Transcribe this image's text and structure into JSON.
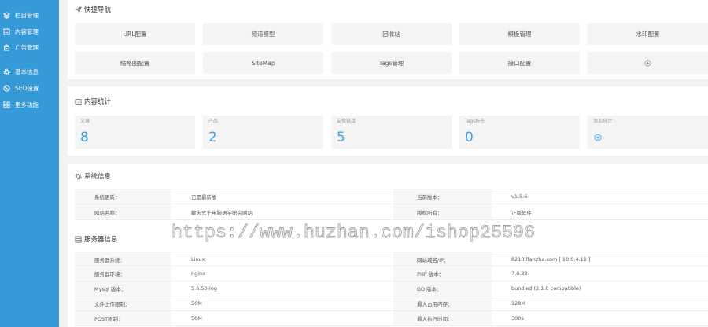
{
  "colors": {
    "sidebar": "#379ad8",
    "accent": "#3ea1e3",
    "page_bg": "#f1f2f4",
    "tile_bg": "#f4f4f4",
    "text": "#333333",
    "muted": "#999999"
  },
  "sidebar": {
    "items": [
      {
        "label": "栏目管理",
        "icon": "layers-icon"
      },
      {
        "label": "内容管理",
        "icon": "document-icon"
      },
      {
        "label": "广告管理",
        "icon": "ad-icon"
      },
      {
        "label": "基本信息",
        "icon": "gear-icon"
      },
      {
        "label": "SEO设置",
        "icon": "seo-icon"
      },
      {
        "label": "更多功能",
        "icon": "grid-icon"
      }
    ]
  },
  "quick_nav": {
    "title": "快捷导航",
    "title_icon": "send-icon",
    "items": [
      "URL配置",
      "频道模型",
      "回收站",
      "模板管理",
      "水印配置",
      "缩略图配置",
      "SiteMap",
      "Tags管理",
      "接口配置"
    ],
    "add_icon": "plus-circle-icon"
  },
  "stats": {
    "title": "内容统计",
    "title_icon": "stats-icon",
    "cards": [
      {
        "label": "文章",
        "value": "8"
      },
      {
        "label": "产品",
        "value": "2"
      },
      {
        "label": "友情链接",
        "value": "5"
      },
      {
        "label": "Tags标签",
        "value": "0"
      }
    ],
    "add": {
      "label": "添加统计",
      "icon": "plus-circle-icon"
    }
  },
  "system": {
    "title": "系统信息",
    "title_icon": "settings-icon",
    "rows": [
      [
        "系统更新：",
        "已是最新版",
        "当前版本：",
        "v1.5.6"
      ],
      [
        "网站名称：",
        "敏志式千电脑语学研究网站",
        "版权所有：",
        "正版软件"
      ]
    ]
  },
  "server": {
    "title": "服务器信息",
    "title_icon": "server-icon",
    "rows": [
      [
        "服务器系统：",
        "Linux",
        "网站域名/IP：",
        "8210.lfanzha.com [ 10.0.4.11 ]"
      ],
      [
        "服务器环境：",
        "nginx",
        "PHP 版本：",
        "7.0.33"
      ],
      [
        "Mysql 版本：",
        "5.6.50-log",
        "GD 版本：",
        "bundled (2.1.0 compatible)"
      ],
      [
        "文件上传限制：",
        "50M",
        "最大占用内存：",
        "128M"
      ],
      [
        "POST限制：",
        "50M",
        "最大执行时间：",
        "300s"
      ]
    ]
  },
  "watermark": "https://www.huzhan.com/ishop25596"
}
